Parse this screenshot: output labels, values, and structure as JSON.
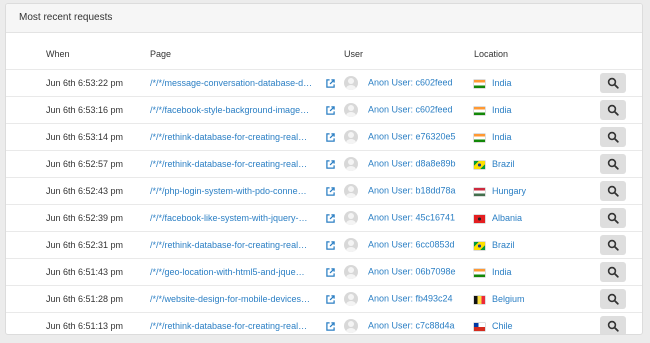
{
  "panel": {
    "title": "Most recent requests"
  },
  "table": {
    "headers": {
      "when": "When",
      "page": "Page",
      "user": "User",
      "location": "Location"
    },
    "rows": [
      {
        "when": "Jun 6th 6:53:22 pm",
        "page": "/*/*/message-conversation-database-d…",
        "user": "Anon User: c602feed",
        "country": "India",
        "flag": "india"
      },
      {
        "when": "Jun 6th 6:53:16 pm",
        "page": "/*/*/facebook-style-background-image…",
        "user": "Anon User: c602feed",
        "country": "India",
        "flag": "india"
      },
      {
        "when": "Jun 6th 6:53:14 pm",
        "page": "/*/*/rethink-database-for-creating-real…",
        "user": "Anon User: e76320e5",
        "country": "India",
        "flag": "india"
      },
      {
        "when": "Jun 6th 6:52:57 pm",
        "page": "/*/*/rethink-database-for-creating-real…",
        "user": "Anon User: d8a8e89b",
        "country": "Brazil",
        "flag": "brazil"
      },
      {
        "when": "Jun 6th 6:52:43 pm",
        "page": "/*/*/php-login-system-with-pdo-conne…",
        "user": "Anon User: b18dd78a",
        "country": "Hungary",
        "flag": "hungary"
      },
      {
        "when": "Jun 6th 6:52:39 pm",
        "page": "/*/*/facebook-like-system-with-jquery-…",
        "user": "Anon User: 45c16741",
        "country": "Albania",
        "flag": "albania"
      },
      {
        "when": "Jun 6th 6:52:31 pm",
        "page": "/*/*/rethink-database-for-creating-real…",
        "user": "Anon User: 6cc0853d",
        "country": "Brazil",
        "flag": "brazil"
      },
      {
        "when": "Jun 6th 6:51:43 pm",
        "page": "/*/*/geo-location-with-html5-and-jque…",
        "user": "Anon User: 06b7098e",
        "country": "India",
        "flag": "india"
      },
      {
        "when": "Jun 6th 6:51:28 pm",
        "page": "/*/*/website-design-for-mobile-devices…",
        "user": "Anon User: fb493c24",
        "country": "Belgium",
        "flag": "belgium"
      },
      {
        "when": "Jun 6th 6:51:13 pm",
        "page": "/*/*/rethink-database-for-creating-real…",
        "user": "Anon User: c7c88d4a",
        "country": "Chile",
        "flag": "chile"
      }
    ]
  },
  "colors": {
    "link": "#2b7fc4",
    "button_bg": "#dedede",
    "header_bg": "#f6f6f6"
  },
  "icons": {
    "page_link": "external-link-icon",
    "row_action": "search-icon",
    "user": "avatar-icon"
  }
}
